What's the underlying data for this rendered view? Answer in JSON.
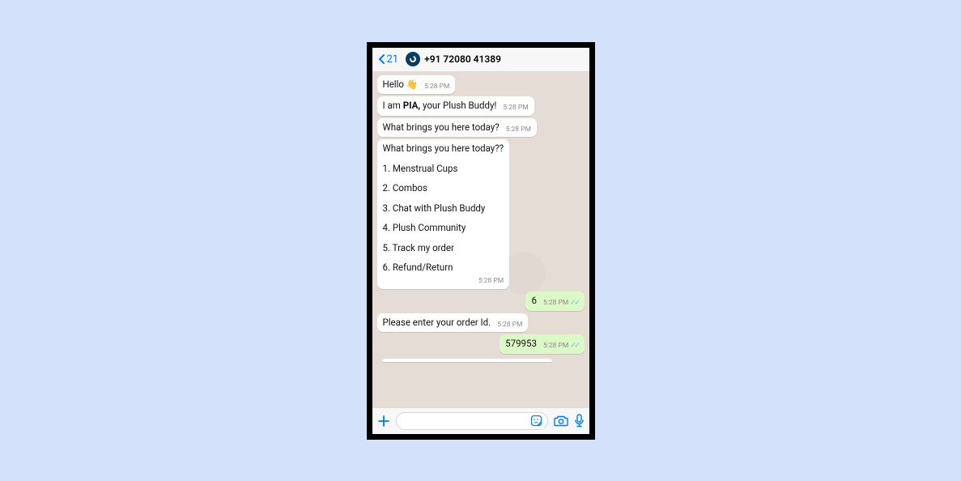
{
  "header": {
    "back_count": "21",
    "contact": "+91 72080 41389"
  },
  "messages": {
    "m1": {
      "text": "Hello ",
      "emoji": "👋",
      "time": "5:28 PM"
    },
    "m2": {
      "prefix": "I am ",
      "bold": "PIA,",
      "suffix": " your Plush Buddy!",
      "time": "5:28 PM"
    },
    "m3": {
      "text": "What brings you here today?",
      "time": "5:28 PM"
    },
    "m4": {
      "title": "What brings you here today??",
      "options": [
        "1. Menstrual Cups",
        "2. Combos",
        "3. Chat with Plush Buddy",
        "4. Plush Community",
        "5. Track my order",
        "6. Refund/Return"
      ],
      "time": "5:28 PM"
    },
    "m5": {
      "text": "6",
      "time": "5:28 PM"
    },
    "m6": {
      "text": "Please enter your order Id.",
      "time": "5:28 PM"
    },
    "m7": {
      "text": "579953",
      "time": "5:28 PM"
    }
  }
}
